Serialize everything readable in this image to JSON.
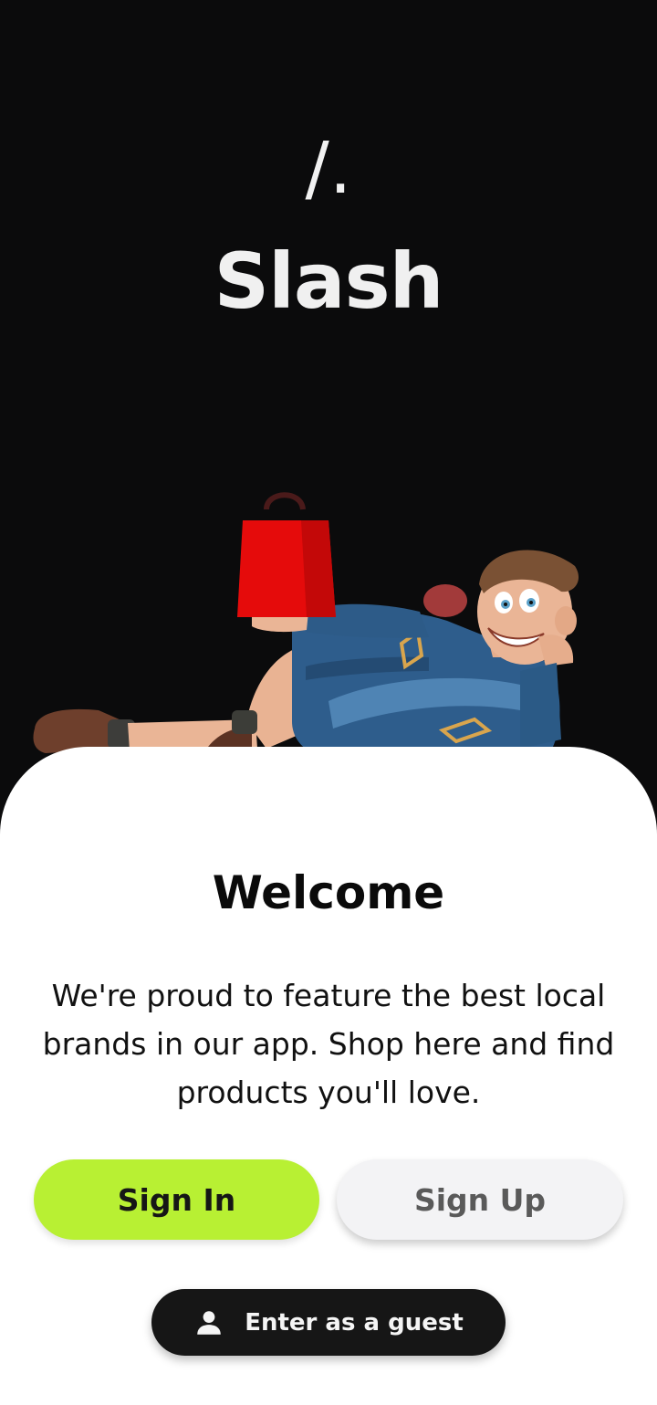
{
  "brand": {
    "logo_mark": "/.",
    "name": "Slash"
  },
  "welcome": {
    "title": "Welcome",
    "body": "We're proud to feature the best local brands in our app. Shop here and find products you'll love."
  },
  "buttons": {
    "sign_in": "Sign In",
    "sign_up": "Sign Up",
    "guest": "Enter as a guest"
  },
  "icons": {
    "guest": "person-icon"
  },
  "colors": {
    "background": "#0b0b0c",
    "sheet": "#ffffff",
    "sign_in_bg": "#b8f033",
    "sign_up_bg": "#f3f3f5",
    "guest_bg": "#161616",
    "bag": "#e50b0b",
    "jacket": "#2e5d8c"
  }
}
